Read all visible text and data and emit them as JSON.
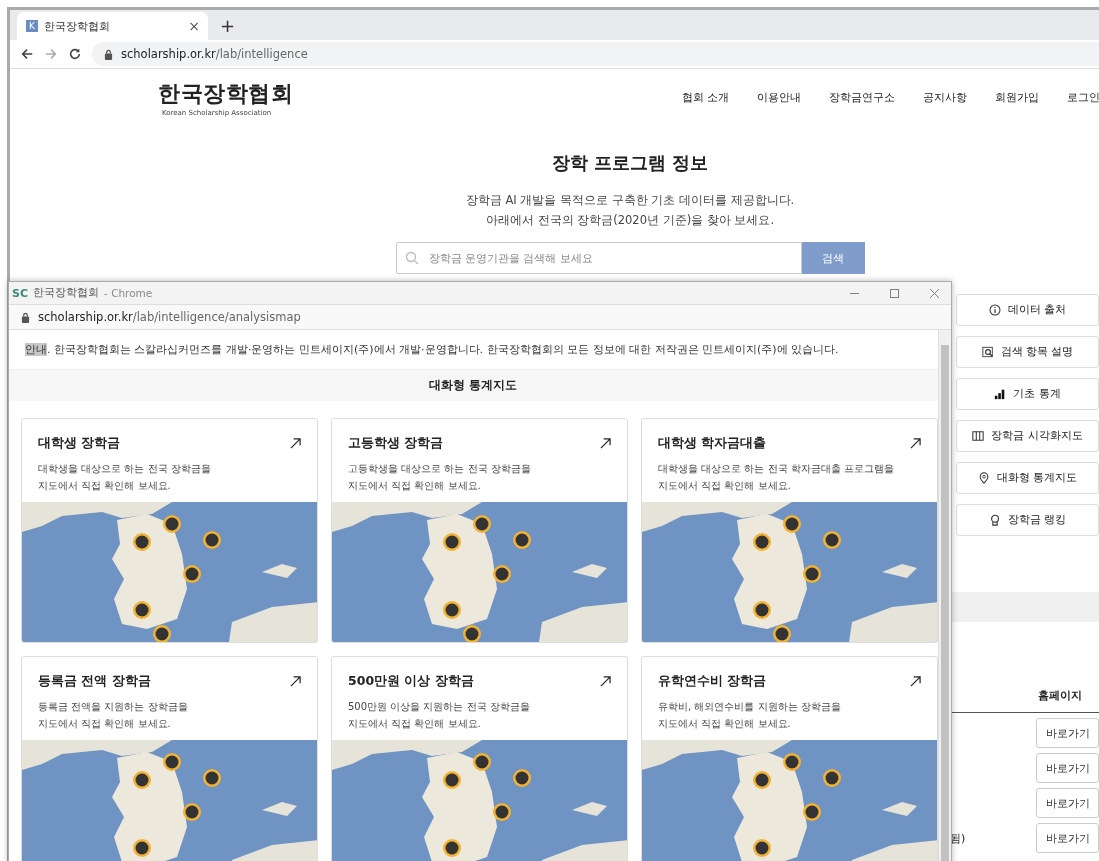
{
  "browser": {
    "tab_favicon": "K",
    "tab_title": "한국장학협회",
    "tab_close": "×",
    "new_tab": "+",
    "url_host": "scholarship.or.kr",
    "url_path": "/lab/intelligence"
  },
  "site": {
    "logo_title": "한국장학협회",
    "logo_subtitle": "Korean Scholarship Association",
    "nav": [
      "협회 소개",
      "이용안내",
      "장학금연구소",
      "공지사항",
      "회원가입",
      "로그인"
    ]
  },
  "hero": {
    "title": "장학 프로그램 정보",
    "lines": [
      "장학금 AI 개발을 목적으로 구축한 기초 데이터를 제공합니다.",
      "아래에서 전국의 장학금(2020년 기준)을 찾아 보세요."
    ],
    "search": {
      "placeholder": "장학금 운영기관을 검색해 보세요",
      "button": "검색"
    }
  },
  "side_buttons": [
    {
      "label": "데이터 출처"
    },
    {
      "label": "검색 항목 설명"
    },
    {
      "label": "기초 통계"
    },
    {
      "label": "장학금 시각화지도"
    },
    {
      "label": "대화형 통계지도"
    },
    {
      "label": "장학금 랭킹"
    }
  ],
  "table": {
    "column": "홈페이지",
    "rows": [
      {
        "link": "바로가기"
      },
      {
        "link": "바로가기"
      },
      {
        "link": "바로가기"
      },
      {
        "cell": "됨)",
        "link": "바로가기"
      }
    ]
  },
  "popup": {
    "favicon": "SC",
    "title": "한국장학협회",
    "app": "- Chrome",
    "url_host": "scholarship.or.kr",
    "url_path": "/lab/intelligence/analysismap",
    "notice": {
      "selected_text": "안내",
      "text": ". 한국장학협회는 스칼라십커먼즈를 개발·운영하는 민트세이지(주)에서 개발·운영합니다. 한국장학협회의 모든 정보에 대한 저작권은 민트세이지(주)에 있습니다."
    },
    "heading": "대화형 통계지도",
    "cards": [
      {
        "title": "대학생 장학금",
        "lines": [
          "대학생을 대상으로 하는 전국 장학금을",
          "지도에서 직접 확인해 보세요."
        ]
      },
      {
        "title": "고등학생 장학금",
        "lines": [
          "고등학생을 대상으로 하는 전국 장학금을",
          "지도에서 직접 확인해 보세요."
        ]
      },
      {
        "title": "대학생 학자금대출",
        "lines": [
          "대학생을 대상으로 하는 전국 학자금대출 프로그램을",
          "지도에서 직접 확인해 보세요."
        ]
      },
      {
        "title": "등록금 전액 장학금",
        "lines": [
          "등록금 전액을 지원하는 장학금을",
          "지도에서 직접 확인해 보세요."
        ]
      },
      {
        "title": "500만원 이상 장학금",
        "lines": [
          "500만원 이상을 지원하는 전국 장학금을",
          "지도에서 직접 확인해 보세요."
        ]
      },
      {
        "title": "유학연수비 장학금",
        "lines": [
          "유학비, 해외연수비를 지원하는 장학금을",
          "지도에서 직접 확인해 보세요."
        ]
      }
    ]
  }
}
